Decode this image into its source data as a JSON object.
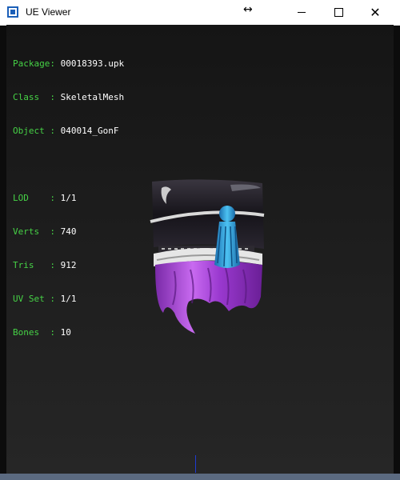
{
  "window": {
    "title": "UE Viewer",
    "buttons": {
      "minimize": "minimize",
      "maximize": "maximize",
      "close": "close"
    }
  },
  "info": {
    "package_label": "Package: ",
    "package_value": "00018393.upk",
    "class_label": "Class  : ",
    "class_value": "SkeletalMesh",
    "object_label": "Object : ",
    "object_value": "040014_GonF",
    "lod_label": "LOD    : ",
    "lod_value": "1/1",
    "verts_label": "Verts  : ",
    "verts_value": "740",
    "tris_label": "Tris   : ",
    "tris_value": "912",
    "uvset_label": "UV Set : ",
    "uvset_value": "1/1",
    "bones_label": "Bones  : ",
    "bones_value": "10"
  },
  "colors": {
    "label": "#46d246",
    "value": "#ffffff",
    "viewport_bg": "#1c1c1c",
    "mesh_purple": "#a93fd6",
    "mesh_blue": "#2fa7e6"
  }
}
